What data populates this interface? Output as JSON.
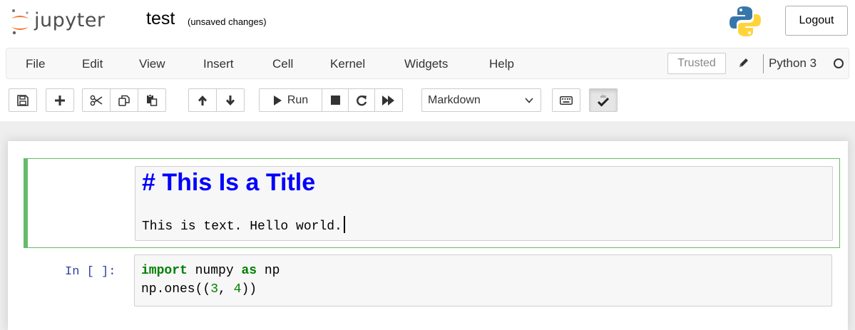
{
  "header": {
    "logo_text": "jupyter",
    "notebook_name": "test",
    "save_status": "(unsaved changes)",
    "logout_label": "Logout"
  },
  "menubar": {
    "items": [
      "File",
      "Edit",
      "View",
      "Insert",
      "Cell",
      "Kernel",
      "Widgets",
      "Help"
    ],
    "trusted_label": "Trusted",
    "kernel_name": "Python 3"
  },
  "toolbar": {
    "run_label": "Run",
    "cell_type": "Markdown",
    "icons": [
      "save-icon",
      "plus-icon",
      "scissors-icon",
      "copy-icon",
      "paste-icon",
      "arrow-up-icon",
      "arrow-down-icon",
      "play-icon",
      "stop-icon",
      "restart-icon",
      "fast-forward-icon",
      "keyboard-icon",
      "spellcheck-icon"
    ]
  },
  "cells": {
    "markdown": {
      "title": "# This Is a Title",
      "text": "This is text. Hello world."
    },
    "code": {
      "prompt": "In [ ]:",
      "line1": {
        "kw1": "import",
        "t1": " numpy ",
        "kw2": "as",
        "t2": " np"
      },
      "line2": {
        "a": "np.ones((",
        "n1": "3",
        "b": ", ",
        "n2": "4",
        "c": "))"
      }
    }
  },
  "colors": {
    "jupyter_orange": "#f37726",
    "edit_mode_green": "#66bb6a",
    "markdown_heading": "#0000ff",
    "prompt_blue": "#303f9f",
    "keyword_green": "#008000"
  }
}
